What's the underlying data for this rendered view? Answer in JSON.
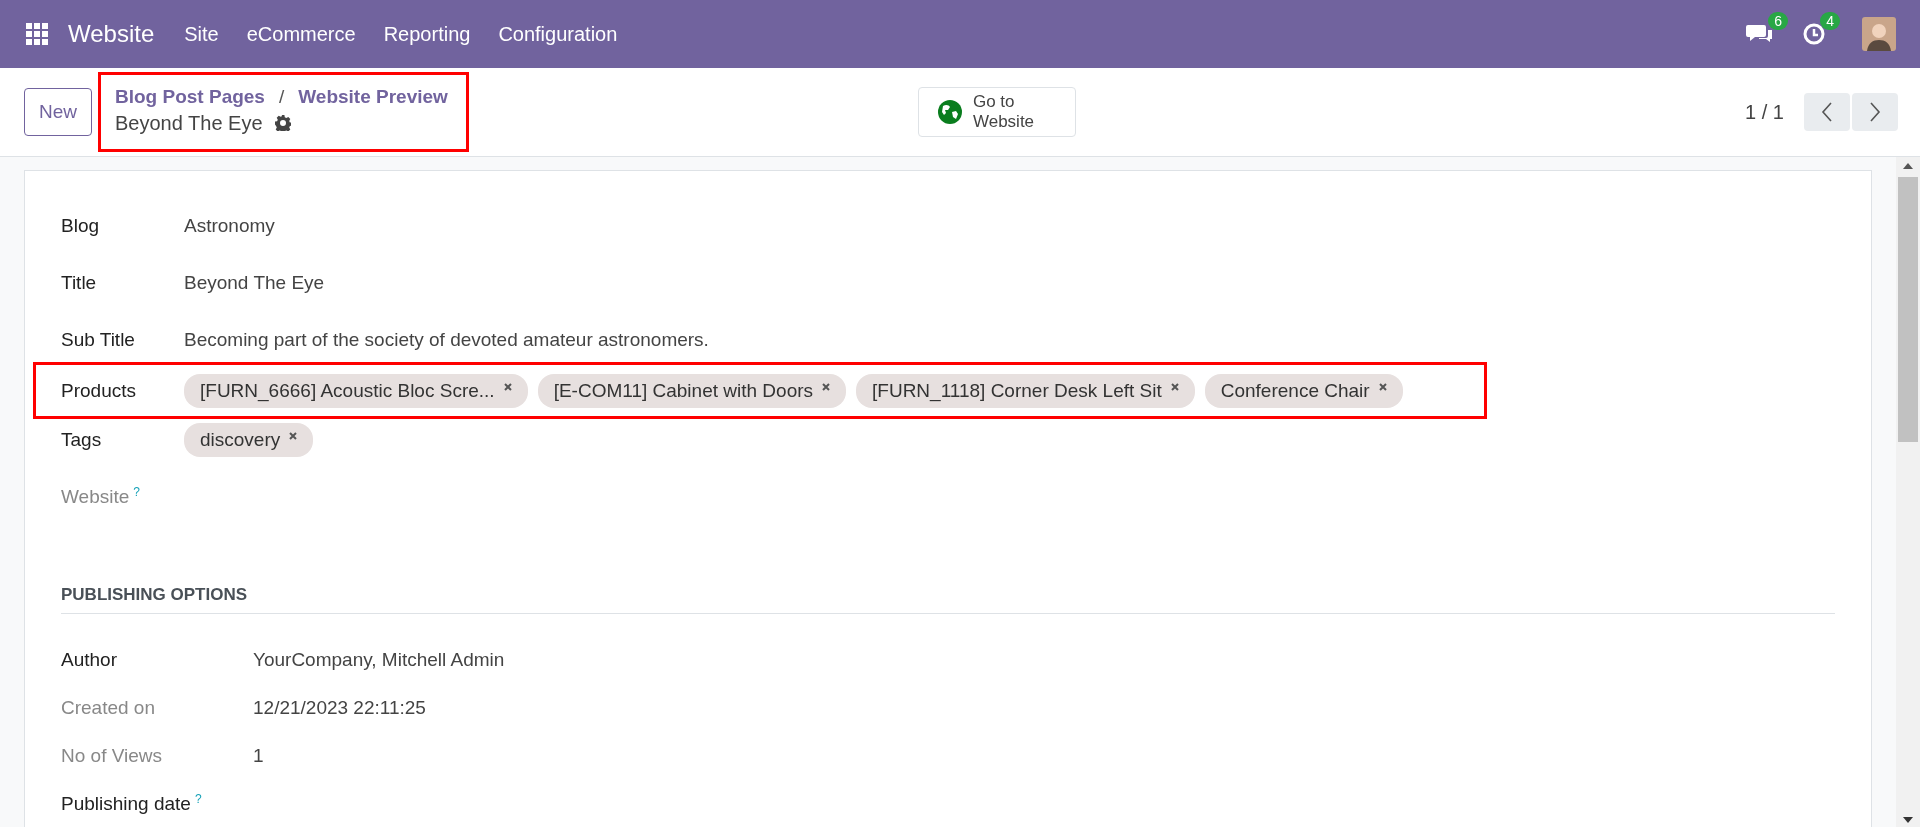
{
  "navbar": {
    "app_name": "Website",
    "menus": [
      "Site",
      "eCommerce",
      "Reporting",
      "Configuration"
    ],
    "messages_badge": "6",
    "activities_badge": "4"
  },
  "control_panel": {
    "new_button": "New",
    "highlighted": true,
    "breadcrumbs": [
      "Blog Post Pages",
      "Website Preview"
    ],
    "separator": "/",
    "record_title": "Beyond The Eye",
    "go_to_website": "Go to Website",
    "pager": "1 / 1"
  },
  "form": {
    "fields": [
      {
        "label": "Blog",
        "kind": "text",
        "value": "Astronomy",
        "bold": true
      },
      {
        "label": "Title",
        "kind": "text",
        "value": "Beyond The Eye",
        "bold": true
      },
      {
        "label": "Sub Title",
        "kind": "text",
        "value": "Becoming part of the society of devoted amateur astronomers.",
        "bold": true
      },
      {
        "label": "Products",
        "kind": "tags",
        "highlighted": true,
        "bold": true,
        "tags": [
          "[FURN_6666] Acoustic Bloc Scre...",
          "[E-COM11] Cabinet with Doors",
          "[FURN_1118] Corner Desk Left Sit",
          "Conference Chair"
        ]
      },
      {
        "label": "Tags",
        "kind": "tags",
        "highlighted": false,
        "bold": true,
        "tags": [
          "discovery"
        ]
      },
      {
        "label": "Website",
        "kind": "help",
        "bold": false,
        "help": "?"
      }
    ],
    "section_title": "PUBLISHING OPTIONS",
    "publishing": [
      {
        "label": "Author",
        "value": "YourCompany, Mitchell Admin",
        "bold": true
      },
      {
        "label": "Created on",
        "value": "12/21/2023 22:11:25",
        "bold": false
      },
      {
        "label": "No of Views",
        "value": "1",
        "bold": false
      },
      {
        "label": "Publishing date",
        "bold": true,
        "help": "?"
      }
    ]
  }
}
